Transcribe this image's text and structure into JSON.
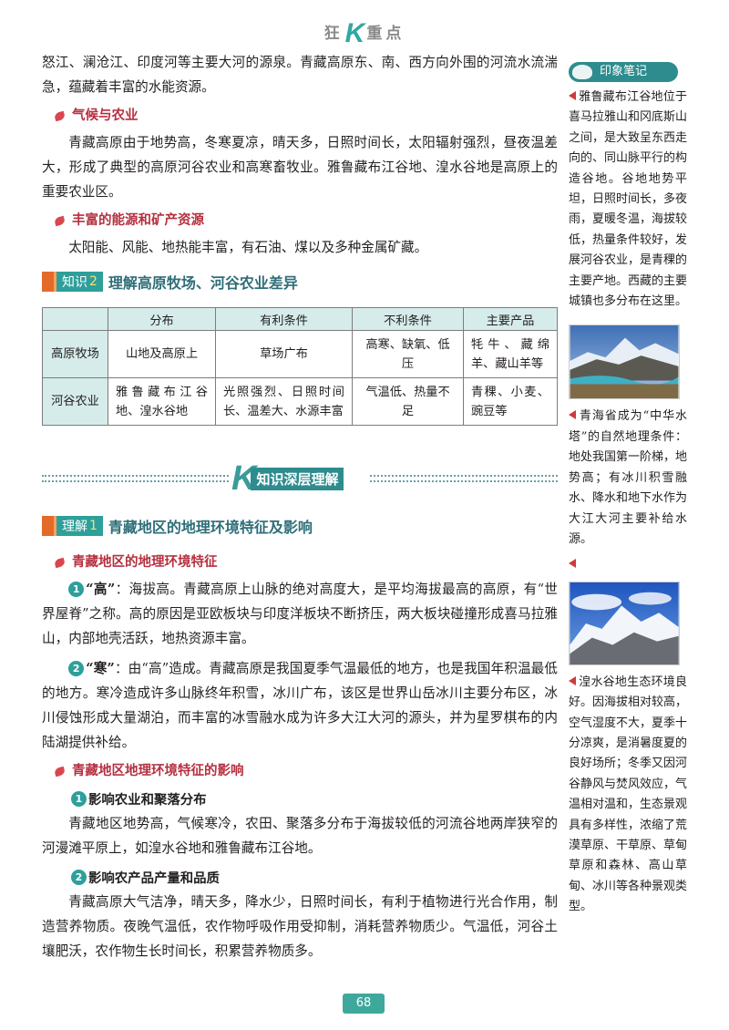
{
  "header": {
    "left": "狂",
    "k": "K",
    "right": "重点"
  },
  "intro": {
    "p1": "怒江、澜沧江、印度河等主要大河的源泉。青藏高原东、南、西方向外围的河流水流湍急，蕴藏着丰富的水能资源。"
  },
  "climate": {
    "heading": "气候与农业",
    "text": "青藏高原由于地势高，冬寒夏凉，晴天多，日照时间长，太阳辐射强烈，昼夜温差大，形成了典型的高原河谷农业和高寒畜牧业。雅鲁藏布江谷地、湟水谷地是高原上的重要农业区。"
  },
  "energy": {
    "heading": "丰富的能源和矿产资源",
    "text": "太阳能、风能、地热能丰富，有石油、煤以及多种金属矿藏。"
  },
  "knowledge2": {
    "tag": "知识",
    "num": "2",
    "title": "理解高原牧场、河谷农业差异",
    "table": {
      "headers": [
        "",
        "分布",
        "有利条件",
        "不利条件",
        "主要产品"
      ],
      "rows": [
        [
          "高原牧场",
          "山地及高原上",
          "草场广布",
          "高寒、缺氧、低压",
          "牦牛、藏绵羊、藏山羊等"
        ],
        [
          "河谷农业",
          "雅鲁藏布江谷地、湟水谷地",
          "光照强烈、日照时间长、温差大、水源丰富",
          "气温低、热量不足",
          "青稞、小麦、豌豆等"
        ]
      ]
    }
  },
  "deep": {
    "k": "K",
    "label": "知识深层理解"
  },
  "understand1": {
    "tag": "理解",
    "num": "1",
    "title": "青藏地区的地理环境特征及影响",
    "features": {
      "heading": "青藏地区的地理环境特征",
      "item1_num": "1",
      "item1_key": "“高”",
      "item1_text": "：海拔高。青藏高原上山脉的绝对高度大，是平均海拔最高的高原，有“世界屋脊”之称。高的原因是亚欧板块与印度洋板块不断挤压，两大板块碰撞形成喜马拉雅山，内部地壳活跃，地热资源丰富。",
      "item2_num": "2",
      "item2_key": "“寒”",
      "item2_text": "：由“高”造成。青藏高原是我国夏季气温最低的地方，也是我国年积温最低的地方。寒冷造成许多山脉终年积雪，冰川广布，该区是世界山岳冰川主要分布区，冰川侵蚀形成大量湖泊，而丰富的冰雪融水成为许多大江大河的源头，并为星罗棋布的内陆湖提供补给。"
    },
    "impacts": {
      "heading": "青藏地区地理环境特征的影响",
      "sub1_num": "1",
      "sub1_title": "影响农业和聚落分布",
      "sub1_text": "青藏地区地势高，气候寒冷，农田、聚落多分布于海拔较低的河流谷地两岸狭窄的河漫滩平原上，如湟水谷地和雅鲁藏布江谷地。",
      "sub2_num": "2",
      "sub2_title": "影响农产品产量和品质",
      "sub2_text": "青藏高原大气洁净，晴天多，降水少，日照时间长，有利于植物进行光合作用，制造营养物质。夜晚气温低，农作物呼吸作用受抑制，消耗营养物质少。气温低，河谷土壤肥沃，农作物生长时间长，积累营养物质多。"
    }
  },
  "page_number": "68",
  "sidebar": {
    "title": "印象笔记",
    "note1": "雅鲁藏布江谷地位于喜马拉雅山和冈底斯山之间，是大致呈东西走向的、同山脉平行的构造谷地。谷地地势平坦，日照时间长，多夜雨，夏暖冬温，海拔较低，热量条件较好，发展河谷农业，是青稞的主要产地。西藏的主要城镇也多分布在这里。",
    "note2": "青海省成为“中华水塔”的自然地理条件：地处我国第一阶梯，地势高；有冰川积雪融水、降水和地下水作为大江大河主要补给水源。",
    "note3": "",
    "note4": "湟水谷地生态环境良好。因海拔相对较高，空气湿度不大，夏季十分凉爽，是消暑度夏的良好场所；冬季又因河谷静风与焚风效应，气温相对温和，生态景观具有多样性，浓缩了荒漠草原、干草原、草甸草原和森林、高山草甸、冰川等各种景观类型。"
  }
}
